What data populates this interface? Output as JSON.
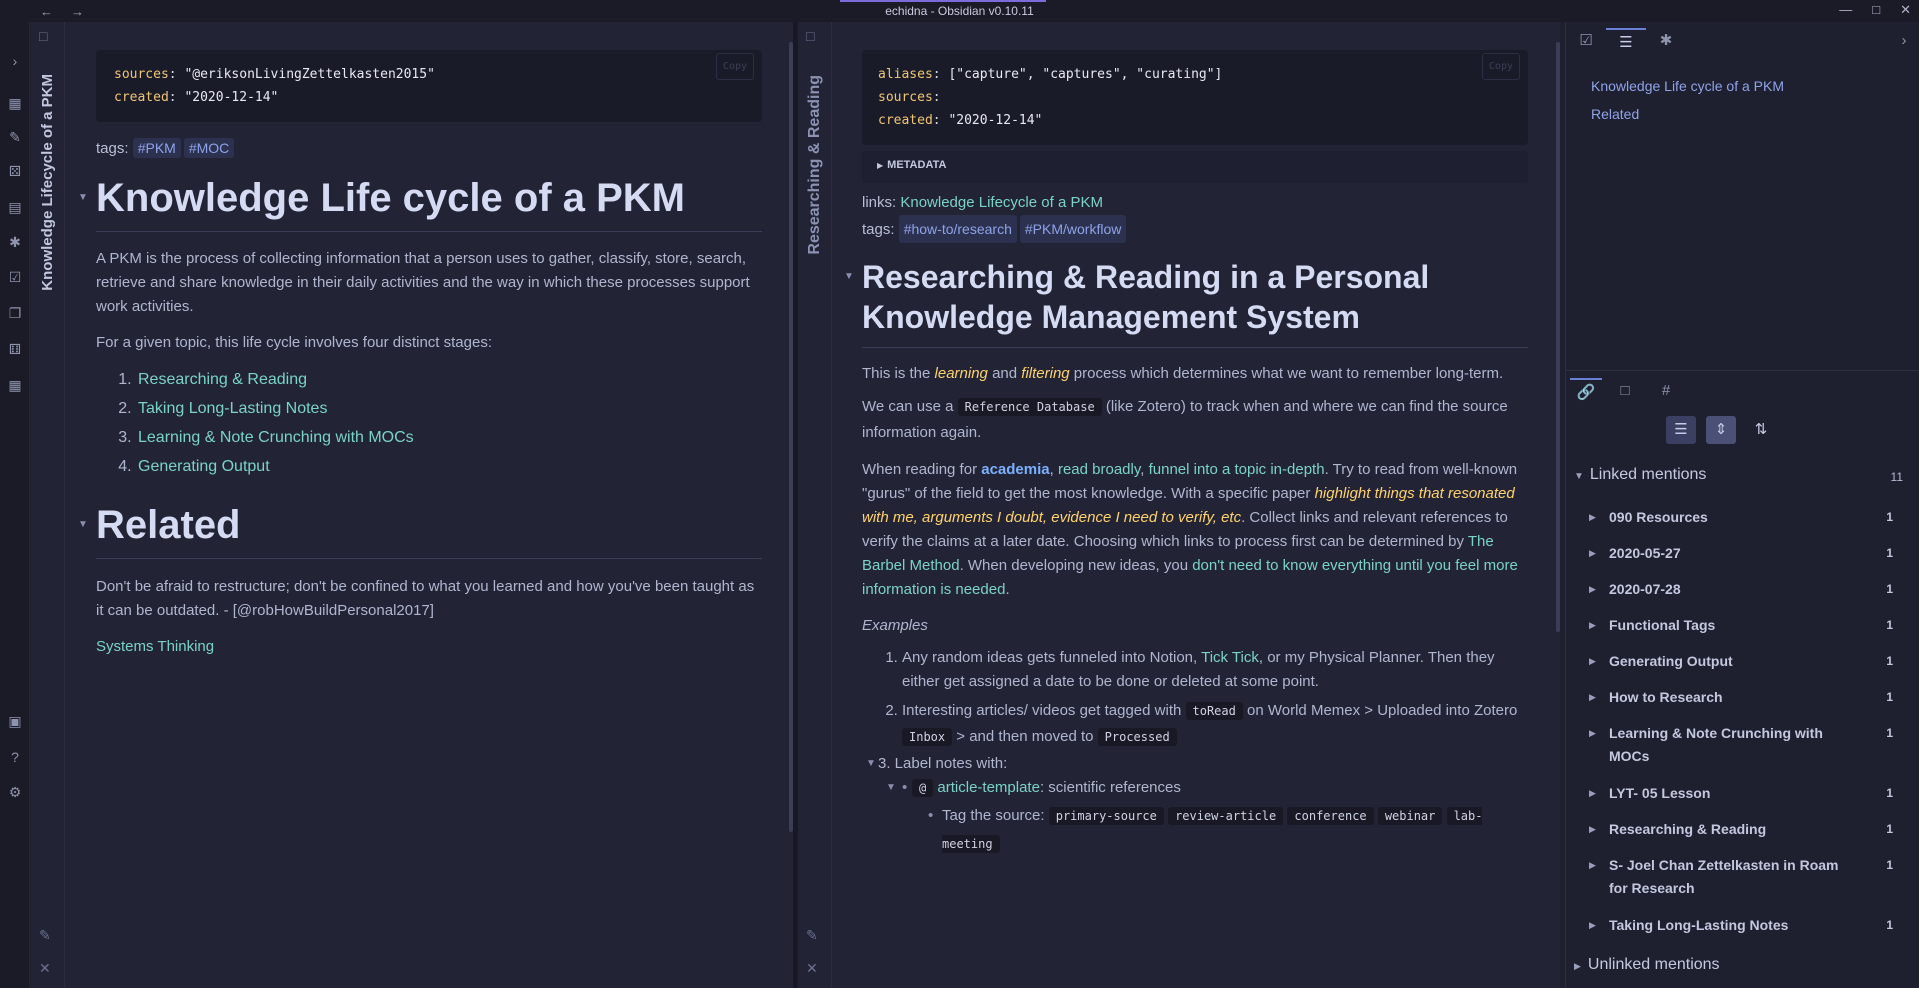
{
  "window": {
    "title": "echidna - Obsidian v0.10.11",
    "back_icon": "←",
    "forward_icon": "→",
    "minimize": "—",
    "maximize": "□",
    "close": "✕"
  },
  "left_pane": {
    "vertical_title": "Knowledge Lifecycle of a PKM",
    "frontmatter": {
      "copy": "Copy",
      "line1_key": "sources",
      "line1_val": "\"@eriksonLivingZettelkasten2015\"",
      "line2_key": "created",
      "line2_val": "\"2020-12-14\""
    },
    "tags_label": "tags:",
    "tags": [
      "#PKM",
      "#MOC"
    ],
    "heading1": "Knowledge Life cycle of a PKM",
    "para1": "A PKM is the process of collecting information that a person uses to gather, classify, store, search, retrieve and share knowledge in their daily activities and the way in which these processes support work activities.",
    "para2": "For a given topic, this life cycle involves four distinct stages:",
    "stages": [
      "Researching & Reading",
      "Taking Long-Lasting Notes",
      "Learning & Note Crunching with MOCs",
      "Generating Output"
    ],
    "heading2": "Related",
    "para3": "Don't be afraid to restructure; don't be confined to what you learned and how you've been taught as it can be outdated. - [@robHowBuildPersonal2017]",
    "related_link": "Systems Thinking"
  },
  "mid_pane": {
    "vertical_title": "Researching & Reading",
    "frontmatter": {
      "copy": "Copy",
      "aliases_key": "aliases",
      "aliases_val": "[\"capture\", \"captures\", \"curating\"]",
      "sources_key": "sources",
      "created_key": "created",
      "created_val": "\"2020-12-14\""
    },
    "metadata_label": "METADATA",
    "links_label": "links:",
    "links_value": "Knowledge Lifecycle of a PKM",
    "tags_label": "tags:",
    "tags": [
      "#how-to/research",
      "#PKM/workflow"
    ],
    "heading": "Researching & Reading in a Personal Knowledge Management System",
    "p1": {
      "a": "This is the ",
      "learning": "learning",
      "and": " and ",
      "filtering": "filtering",
      "b": " process which determines what we want to remember long-term."
    },
    "p2": {
      "a": "We can use a ",
      "code": "Reference Database",
      "b": " (like Zotero) to track when and where we can find the source information again."
    },
    "p3": {
      "a": "When reading for ",
      "academia": "academia",
      "comma": ", ",
      "read_broadly": "read broadly",
      "comma2": ", ",
      "funnel": "funnel into a topic in-depth",
      "b": ". Try to read from well-known \"gurus\" of the field to get the most knowledge. With a specific paper ",
      "highlight": "highlight things that resonated with me, arguments I doubt, evidence I need to verify, etc",
      "c": ". Collect links and relevant references to verify the claims at a later date. Choosing which links to process first can be determined by ",
      "barbel": "The Barbel Method",
      "d": ". When developing new ideas, you ",
      "dont_need": "don't need to know everything until you feel more information is needed",
      "e": "."
    },
    "examples_label": "Examples",
    "ex1": {
      "a": "Any random ideas gets funneled into Notion, ",
      "ticktick": "Tick Tick",
      "b": ", or my Physical Planner. Then they either get assigned a date to be done or deleted at some point."
    },
    "ex2": {
      "a": "Interesting articles/ videos get tagged with ",
      "code1": "toRead",
      "b": " on World Memex > Uploaded into Zotero ",
      "code2": "Inbox",
      "c": " > and then moved to ",
      "code3": "Processed"
    },
    "ex3": "3. Label notes with:",
    "ex3_sub": {
      "at": "@",
      "template": "article-template",
      "rest": ": scientific references"
    },
    "tag_source_label": "Tag the source:",
    "tag_source_codes": [
      "primary-source",
      "review-article",
      "conference",
      "webinar",
      "lab-meeting"
    ]
  },
  "right_sidebar": {
    "outline": [
      "Knowledge Life cycle of a PKM",
      "Related"
    ],
    "linked_mentions_label": "Linked mentions",
    "linked_mentions_count": "11",
    "linked_items": [
      {
        "label": "090 Resources",
        "count": "1"
      },
      {
        "label": "2020-05-27",
        "count": "1"
      },
      {
        "label": "2020-07-28",
        "count": "1"
      },
      {
        "label": "Functional Tags",
        "count": "1"
      },
      {
        "label": "Generating Output",
        "count": "1"
      },
      {
        "label": "How to Research",
        "count": "1"
      },
      {
        "label": "Learning & Note Crunching with MOCs",
        "count": "1"
      },
      {
        "label": "LYT- 05 Lesson",
        "count": "1"
      },
      {
        "label": "Researching & Reading",
        "count": "1"
      },
      {
        "label": "S- Joel Chan Zettelkasten in Roam for Research",
        "count": "1"
      },
      {
        "label": "Taking Long-Lasting Notes",
        "count": "1"
      }
    ],
    "unlinked_mentions_label": "Unlinked mentions"
  }
}
